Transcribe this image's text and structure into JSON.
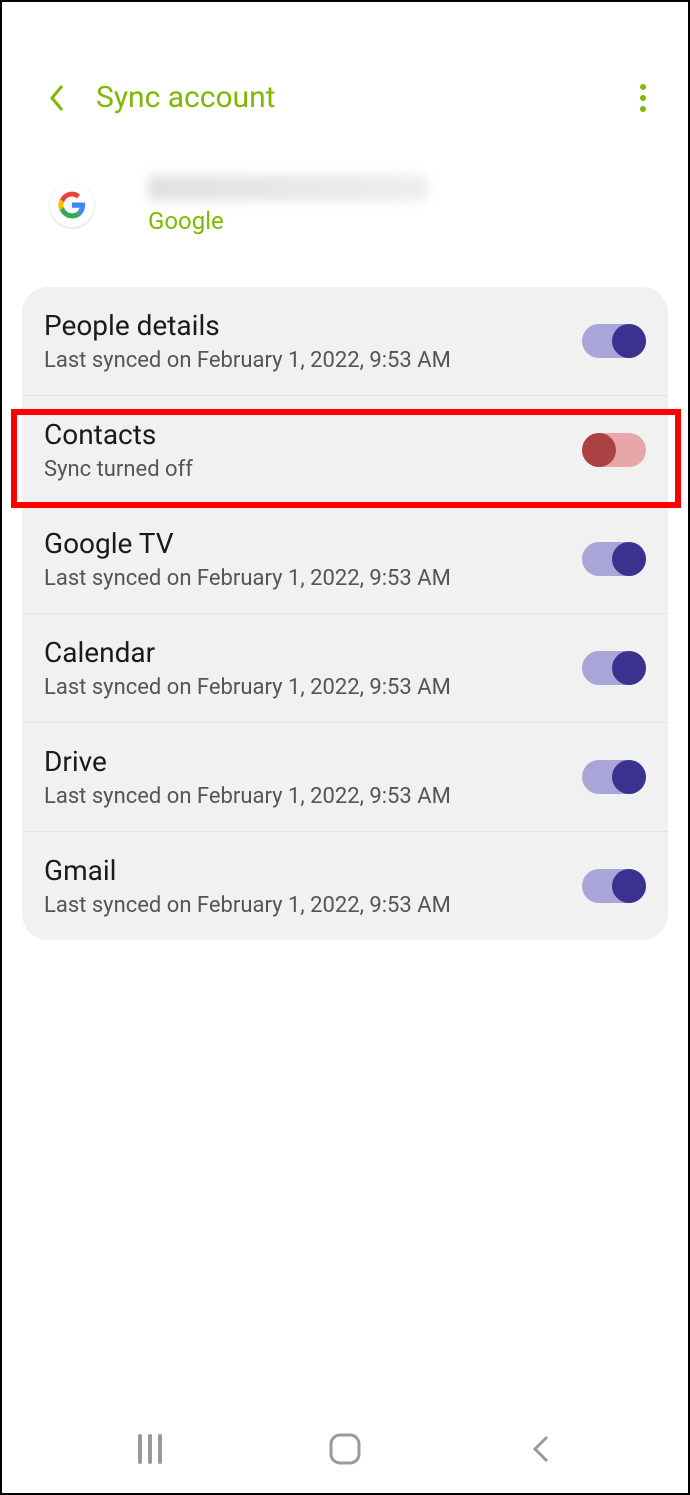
{
  "header": {
    "title": "Sync account"
  },
  "account": {
    "provider": "Google"
  },
  "sync_items": [
    {
      "title": "People details",
      "subtitle": "Last synced on February 1, 2022, 9:53 AM",
      "enabled": true
    },
    {
      "title": "Contacts",
      "subtitle": "Sync turned off",
      "enabled": false
    },
    {
      "title": "Google TV",
      "subtitle": "Last synced on February 1, 2022, 9:53 AM",
      "enabled": true
    },
    {
      "title": "Calendar",
      "subtitle": "Last synced on February 1, 2022, 9:53 AM",
      "enabled": true
    },
    {
      "title": "Drive",
      "subtitle": "Last synced on February 1, 2022, 9:53 AM",
      "enabled": true
    },
    {
      "title": "Gmail",
      "subtitle": "Last synced on February 1, 2022, 9:53 AM",
      "enabled": true
    }
  ],
  "highlighted_index": 1
}
